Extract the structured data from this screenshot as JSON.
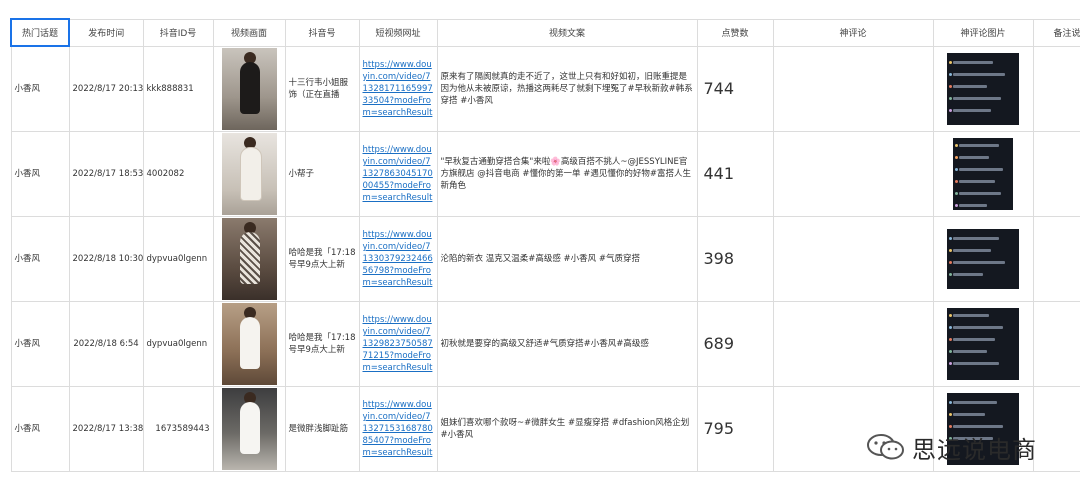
{
  "headers": [
    "热门话题",
    "发布时间",
    "抖音ID号",
    "视频画面",
    "抖音号",
    "短视频网址",
    "视频文案",
    "点赞数",
    "神评论",
    "神评论图片",
    "备注说"
  ],
  "rows": [
    {
      "topic": "小香风",
      "time": "2022/8/17 20:13",
      "id": "kkk888831",
      "account": "十三行韦小姐服饰（正在直播",
      "url": "https://www.douyin.com/video/7132817116599733504?modeFrom=searchResult",
      "caption": "原来有了隔阂就真的走不近了，这世上只有和好如初，旧账重提是因为他从未被原谅，热播这两耗尽了就剩下埋冤了#早秋新款#韩系穿搭 #小香风",
      "likes": "744"
    },
    {
      "topic": "小香风",
      "time": "2022/8/17 18:53",
      "id": "4002082",
      "account": "小帮子",
      "url": "https://www.douyin.com/video/7132786304517000455?modeFrom=searchResult",
      "caption": "\"早秋复古通勤穿搭合集\"来啦🌸高级百搭不挑人~@JESSYLINE官方旗舰店 @抖音电商 #懂你的第一单 #遇见懂你的好物#富搭人生新角色",
      "likes": "441"
    },
    {
      "topic": "小香风",
      "time": "2022/8/18 10:30",
      "id": "dypvua0lgenn",
      "account": "哈哈是我「17:18号早9点大上新",
      "url": "https://www.douyin.com/video/7133037923246656798?modeFrom=searchResult",
      "caption": "沦陷的新衣 温克又温柔#高级感 #小香风 #气质穿搭",
      "likes": "398"
    },
    {
      "topic": "小香风",
      "time": "2022/8/18 6:54",
      "id": "dypvua0lgenn",
      "account": "哈哈是我「17:18号早9点大上新",
      "url": "https://www.douyin.com/video/7132982375058771215?modeFrom=searchResult",
      "caption": "初秋就是要穿的高级又舒适#气质穿搭#小香风#高级感",
      "likes": "689"
    },
    {
      "topic": "小香风",
      "time": "2022/8/17 13:38",
      "id": "1673589443",
      "account": "是微胖浅脚趾筋",
      "url": "https://www.douyin.com/video/7132715316878085407?modeFrom=searchResult",
      "caption": "姐妹们喜欢哪个款呀~#微胖女生 #显瘦穿搭 #dfashion风格企划 #小香风",
      "likes": "795"
    }
  ],
  "watermark": {
    "text": "思远说电商",
    "icon": "wechat-icon"
  }
}
